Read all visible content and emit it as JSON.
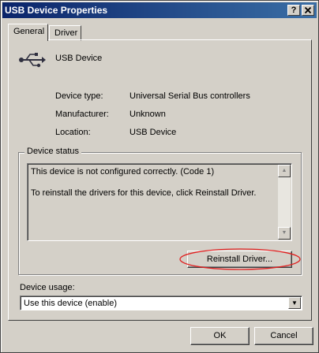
{
  "window": {
    "title": "USB Device Properties",
    "help_label": "?",
    "close_label": "X"
  },
  "tabs": [
    {
      "label": "General",
      "active": true
    },
    {
      "label": "Driver",
      "active": false
    }
  ],
  "device": {
    "name": "USB Device",
    "icon": "usb-icon",
    "properties": [
      {
        "label": "Device type:",
        "value": "Universal Serial Bus controllers"
      },
      {
        "label": "Manufacturer:",
        "value": "Unknown"
      },
      {
        "label": "Location:",
        "value": "USB Device"
      }
    ]
  },
  "status": {
    "group_title": "Device status",
    "lines": [
      "This device is not configured correctly. (Code 1)",
      "To reinstall the drivers for this device, click Reinstall Driver."
    ],
    "button_label": "Reinstall Driver...",
    "highlight_color": "#e02020"
  },
  "usage": {
    "label": "Device usage:",
    "selected": "Use this device (enable)"
  },
  "footer": {
    "ok_label": "OK",
    "cancel_label": "Cancel"
  },
  "colors": {
    "titlebar_start": "#0a246a",
    "titlebar_end": "#3a6ea5",
    "face": "#d4d0c8"
  }
}
